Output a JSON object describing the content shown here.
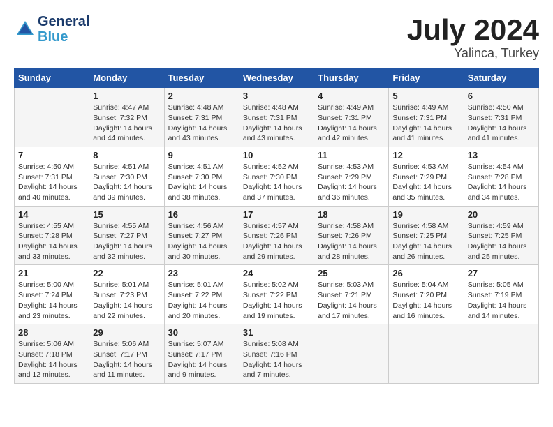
{
  "header": {
    "logo_general": "General",
    "logo_blue": "Blue",
    "title": "July 2024",
    "location": "Yalinca, Turkey"
  },
  "days_of_week": [
    "Sunday",
    "Monday",
    "Tuesday",
    "Wednesday",
    "Thursday",
    "Friday",
    "Saturday"
  ],
  "weeks": [
    [
      {
        "day": "",
        "info": ""
      },
      {
        "day": "1",
        "info": "Sunrise: 4:47 AM\nSunset: 7:32 PM\nDaylight: 14 hours\nand 44 minutes."
      },
      {
        "day": "2",
        "info": "Sunrise: 4:48 AM\nSunset: 7:31 PM\nDaylight: 14 hours\nand 43 minutes."
      },
      {
        "day": "3",
        "info": "Sunrise: 4:48 AM\nSunset: 7:31 PM\nDaylight: 14 hours\nand 43 minutes."
      },
      {
        "day": "4",
        "info": "Sunrise: 4:49 AM\nSunset: 7:31 PM\nDaylight: 14 hours\nand 42 minutes."
      },
      {
        "day": "5",
        "info": "Sunrise: 4:49 AM\nSunset: 7:31 PM\nDaylight: 14 hours\nand 41 minutes."
      },
      {
        "day": "6",
        "info": "Sunrise: 4:50 AM\nSunset: 7:31 PM\nDaylight: 14 hours\nand 41 minutes."
      }
    ],
    [
      {
        "day": "7",
        "info": "Sunrise: 4:50 AM\nSunset: 7:31 PM\nDaylight: 14 hours\nand 40 minutes."
      },
      {
        "day": "8",
        "info": "Sunrise: 4:51 AM\nSunset: 7:30 PM\nDaylight: 14 hours\nand 39 minutes."
      },
      {
        "day": "9",
        "info": "Sunrise: 4:51 AM\nSunset: 7:30 PM\nDaylight: 14 hours\nand 38 minutes."
      },
      {
        "day": "10",
        "info": "Sunrise: 4:52 AM\nSunset: 7:30 PM\nDaylight: 14 hours\nand 37 minutes."
      },
      {
        "day": "11",
        "info": "Sunrise: 4:53 AM\nSunset: 7:29 PM\nDaylight: 14 hours\nand 36 minutes."
      },
      {
        "day": "12",
        "info": "Sunrise: 4:53 AM\nSunset: 7:29 PM\nDaylight: 14 hours\nand 35 minutes."
      },
      {
        "day": "13",
        "info": "Sunrise: 4:54 AM\nSunset: 7:28 PM\nDaylight: 14 hours\nand 34 minutes."
      }
    ],
    [
      {
        "day": "14",
        "info": "Sunrise: 4:55 AM\nSunset: 7:28 PM\nDaylight: 14 hours\nand 33 minutes."
      },
      {
        "day": "15",
        "info": "Sunrise: 4:55 AM\nSunset: 7:27 PM\nDaylight: 14 hours\nand 32 minutes."
      },
      {
        "day": "16",
        "info": "Sunrise: 4:56 AM\nSunset: 7:27 PM\nDaylight: 14 hours\nand 30 minutes."
      },
      {
        "day": "17",
        "info": "Sunrise: 4:57 AM\nSunset: 7:26 PM\nDaylight: 14 hours\nand 29 minutes."
      },
      {
        "day": "18",
        "info": "Sunrise: 4:58 AM\nSunset: 7:26 PM\nDaylight: 14 hours\nand 28 minutes."
      },
      {
        "day": "19",
        "info": "Sunrise: 4:58 AM\nSunset: 7:25 PM\nDaylight: 14 hours\nand 26 minutes."
      },
      {
        "day": "20",
        "info": "Sunrise: 4:59 AM\nSunset: 7:25 PM\nDaylight: 14 hours\nand 25 minutes."
      }
    ],
    [
      {
        "day": "21",
        "info": "Sunrise: 5:00 AM\nSunset: 7:24 PM\nDaylight: 14 hours\nand 23 minutes."
      },
      {
        "day": "22",
        "info": "Sunrise: 5:01 AM\nSunset: 7:23 PM\nDaylight: 14 hours\nand 22 minutes."
      },
      {
        "day": "23",
        "info": "Sunrise: 5:01 AM\nSunset: 7:22 PM\nDaylight: 14 hours\nand 20 minutes."
      },
      {
        "day": "24",
        "info": "Sunrise: 5:02 AM\nSunset: 7:22 PM\nDaylight: 14 hours\nand 19 minutes."
      },
      {
        "day": "25",
        "info": "Sunrise: 5:03 AM\nSunset: 7:21 PM\nDaylight: 14 hours\nand 17 minutes."
      },
      {
        "day": "26",
        "info": "Sunrise: 5:04 AM\nSunset: 7:20 PM\nDaylight: 14 hours\nand 16 minutes."
      },
      {
        "day": "27",
        "info": "Sunrise: 5:05 AM\nSunset: 7:19 PM\nDaylight: 14 hours\nand 14 minutes."
      }
    ],
    [
      {
        "day": "28",
        "info": "Sunrise: 5:06 AM\nSunset: 7:18 PM\nDaylight: 14 hours\nand 12 minutes."
      },
      {
        "day": "29",
        "info": "Sunrise: 5:06 AM\nSunset: 7:17 PM\nDaylight: 14 hours\nand 11 minutes."
      },
      {
        "day": "30",
        "info": "Sunrise: 5:07 AM\nSunset: 7:17 PM\nDaylight: 14 hours\nand 9 minutes."
      },
      {
        "day": "31",
        "info": "Sunrise: 5:08 AM\nSunset: 7:16 PM\nDaylight: 14 hours\nand 7 minutes."
      },
      {
        "day": "",
        "info": ""
      },
      {
        "day": "",
        "info": ""
      },
      {
        "day": "",
        "info": ""
      }
    ]
  ]
}
